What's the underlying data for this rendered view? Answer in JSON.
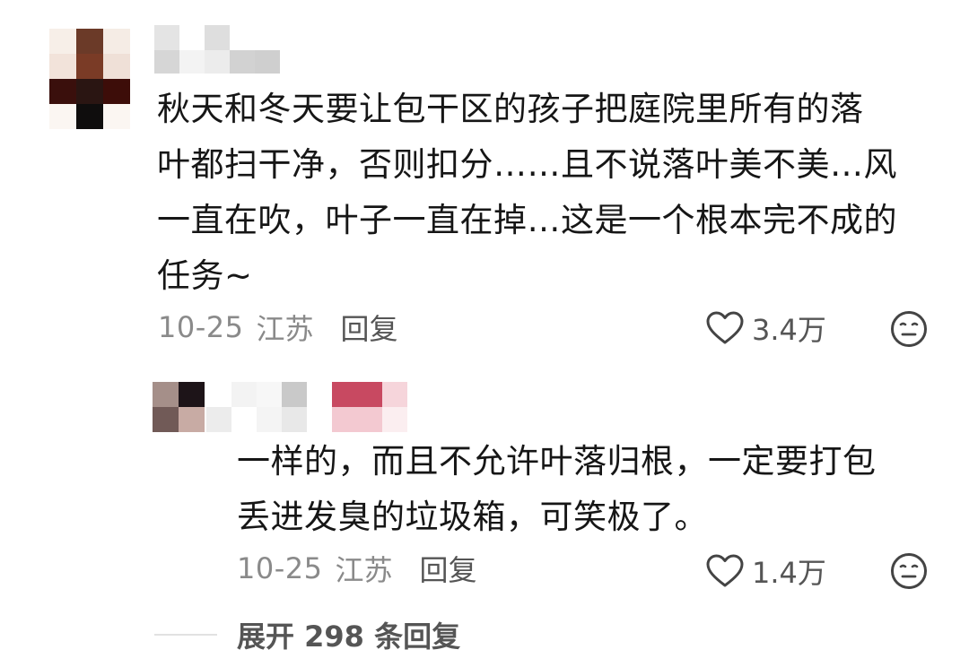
{
  "comments": [
    {
      "text": "秋天和冬天要让包干区的孩子把庭院里所有的落\n叶都扫干净，否则扣分……且不说落叶美不美…风\n一直在吹，叶子一直在掉…这是一个根本完不成的\n任务~",
      "date": "10-25",
      "location": "江苏",
      "reply_label": "回复",
      "likes": "3.4万",
      "replies": [
        {
          "text": "一样的，而且不允许叶落归根，一定要打包\n丢进发臭的垃圾箱，可笑极了。",
          "date": "10-25",
          "location": "江苏",
          "reply_label": "回复",
          "likes": "1.4万"
        }
      ],
      "expand_label": "展开 298 条回复"
    }
  ],
  "icons": {
    "like": "heart-outline-icon",
    "emoji": "neutral-face-icon"
  },
  "colors": {
    "text": "#161616",
    "meta": "#8a8a8a",
    "action": "#555555"
  }
}
